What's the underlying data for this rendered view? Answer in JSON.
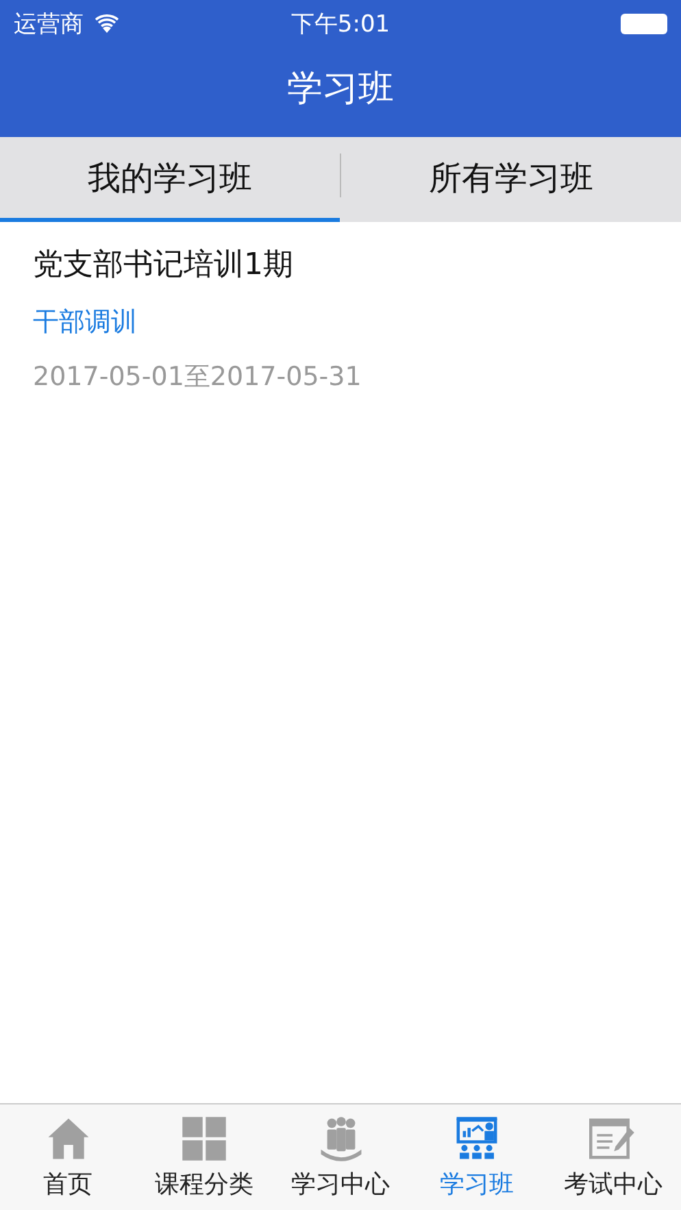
{
  "status_bar": {
    "carrier": "运营商",
    "time": "下午5:01"
  },
  "header": {
    "title": "学习班"
  },
  "tabs": [
    {
      "label": "我的学习班",
      "selected": true
    },
    {
      "label": "所有学习班",
      "selected": false
    }
  ],
  "classes": [
    {
      "title": "党支部书记培训1期",
      "category": "干部调训",
      "dates": "2017-05-01至2017-05-31"
    }
  ],
  "tab_bar": [
    {
      "label": "首页",
      "kind": "home",
      "selected": false
    },
    {
      "label": "课程分类",
      "kind": "grid",
      "selected": false
    },
    {
      "label": "学习中心",
      "kind": "people",
      "selected": false
    },
    {
      "label": "学习班",
      "kind": "presentation",
      "selected": true
    },
    {
      "label": "考试中心",
      "kind": "exam",
      "selected": false
    }
  ]
}
